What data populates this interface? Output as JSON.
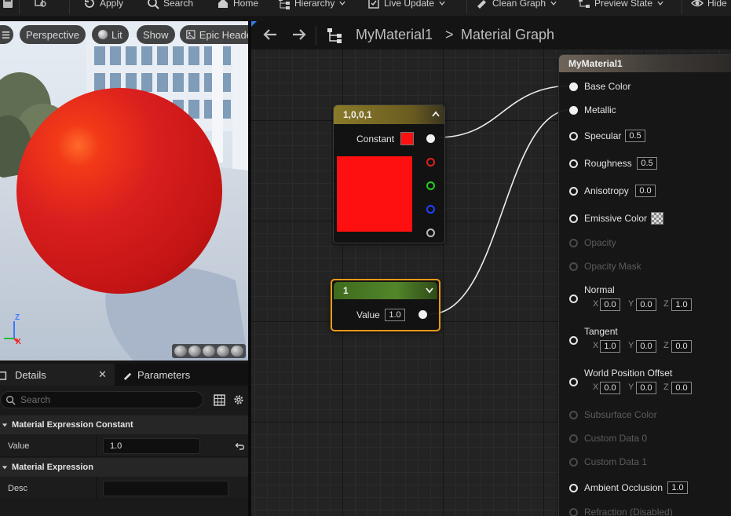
{
  "toolbar": {
    "apply": "Apply",
    "search": "Search",
    "home": "Home",
    "hierarchy": "Hierarchy",
    "live_update": "Live Update",
    "clean_graph": "Clean Graph",
    "preview_state": "Preview State",
    "hide": "Hide"
  },
  "viewport": {
    "perspective": "Perspective",
    "lit": "Lit",
    "show": "Show",
    "epic": "Epic Heade",
    "axis_z": "Z",
    "axis_x": "X"
  },
  "details": {
    "tab_details": "Details",
    "tab_parameters": "Parameters",
    "search_placeholder": "Search",
    "section_constant": "Material Expression Constant",
    "value_label": "Value",
    "value": "1.0",
    "section_expression": "Material Expression",
    "desc_label": "Desc",
    "desc": ""
  },
  "graph": {
    "breadcrumb_material": "MyMaterial1",
    "breadcrumb_sep": ">",
    "breadcrumb_graph": "Material Graph"
  },
  "const3_node": {
    "title": "1,0,0,1",
    "output_label": "Constant",
    "color": "#ff1010",
    "header_color": "#8a7a2a"
  },
  "const_node": {
    "title": "1",
    "output_label": "Value",
    "value": "1.0",
    "header_color": "#4f7a23"
  },
  "result_node": {
    "title": "MyMaterial1",
    "pins": {
      "base_color": "Base Color",
      "metallic": "Metallic",
      "specular": "Specular",
      "specular_val": "0.5",
      "roughness": "Roughness",
      "roughness_val": "0.5",
      "anisotropy": "Anisotropy",
      "anisotropy_val": "0.0",
      "emissive": "Emissive Color",
      "opacity": "Opacity",
      "opacity_mask": "Opacity Mask",
      "normal": "Normal",
      "normal_x": "0.0",
      "normal_y": "0.0",
      "normal_z": "1.0",
      "tangent": "Tangent",
      "tangent_x": "1.0",
      "tangent_y": "0.0",
      "tangent_z": "0.0",
      "wpo": "World Position Offset",
      "wpo_x": "0.0",
      "wpo_y": "0.0",
      "wpo_z": "0.0",
      "subsurface": "Subsurface Color",
      "custom0": "Custom Data 0",
      "custom1": "Custom Data 1",
      "ao": "Ambient Occlusion",
      "ao_val": "1.0",
      "refraction": "Refraction (Disabled)",
      "x": "X",
      "y": "Y",
      "z": "Z"
    }
  }
}
